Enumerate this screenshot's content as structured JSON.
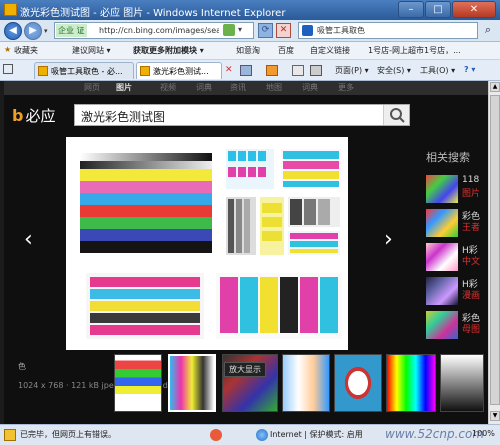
{
  "window": {
    "title": "激光彩色测试图 - 必应 图片 - Windows Internet Explorer",
    "minimize": "–",
    "maximize": "□",
    "close": "✕"
  },
  "address": {
    "secure_badge": "企业 证",
    "url": "http://cn.bing.com/images/search?q=激光...",
    "search_text": "吸管工具取色"
  },
  "favorites": {
    "label": "收藏夹",
    "items": [
      "建议网站 ▾",
      "获取更多附加模块 ▾",
      "如意淘",
      "百度",
      "自定义链接",
      "1号店-网上超市1号店，..."
    ]
  },
  "tabs": [
    {
      "label": "吸管工具取色 - 必..."
    },
    {
      "label": "激光彩色测试..."
    }
  ],
  "commands": [
    "页面(P) ▾",
    "安全(S) ▾",
    "工具(O) ▾",
    "? ▾"
  ],
  "page": {
    "nav": [
      "网页",
      "图片",
      "视频",
      "词典",
      "资讯",
      "地图",
      "词典",
      "更多"
    ],
    "active_nav": "图片",
    "logo": "必应",
    "query": "激光彩色测试图",
    "related_title": "相关搜索",
    "related_items": [
      {
        "text": "118",
        "color": "#e03030"
      },
      {
        "text": "图片",
        "color": "#e03030"
      },
      {
        "text": "彩色",
        "color": "#dddddd"
      },
      {
        "text": "王者",
        "color": "#e03030"
      },
      {
        "text": "H彩",
        "color": "#dddddd"
      },
      {
        "text": "中文",
        "color": "#e03030"
      },
      {
        "text": "H彩",
        "color": "#dddddd"
      },
      {
        "text": "漫画",
        "color": "#e03030"
      },
      {
        "text": "彩色",
        "color": "#dddddd"
      },
      {
        "text": "母图",
        "color": "#e03030"
      }
    ],
    "caption": "色",
    "size_info": "1024 x 768 · 121 kB  jpeg · baike.baidu.com",
    "enlarge": "放大显示",
    "prev_arrow": "‹",
    "next_arrow": "›"
  },
  "status": {
    "left": "已完毕，但网页上有错误。",
    "zone": "Internet | 保护模式: 启用",
    "zoom": "100%",
    "watermark": "www.52cnp.com"
  },
  "colors": {
    "window_title": "#2a5a9a",
    "page_bg": "#0f0f0f",
    "bing_orange": "#f0a020"
  }
}
